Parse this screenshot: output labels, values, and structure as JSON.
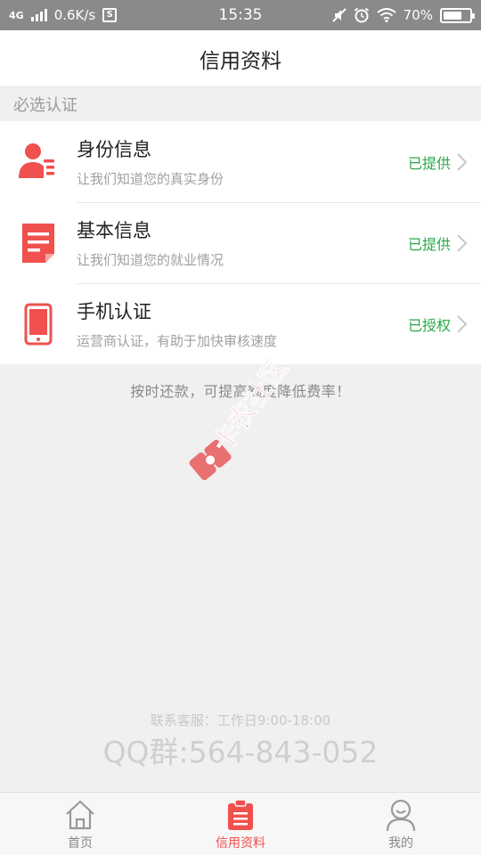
{
  "status_bar": {
    "network": "4G",
    "speed": "0.6K/s",
    "sim_label": "S",
    "time": "15:35",
    "battery": "70%",
    "battery_level": 0.7
  },
  "header": {
    "title": "信用资料"
  },
  "section": {
    "title": "必选认证"
  },
  "items": [
    {
      "title": "身份信息",
      "desc": "让我们知道您的真实身份",
      "status": "已提供",
      "icon": "id-card-icon"
    },
    {
      "title": "基本信息",
      "desc": "让我们知道您的就业情况",
      "status": "已提供",
      "icon": "document-icon"
    },
    {
      "title": "手机认证",
      "desc": "运营商认证，有助于加快审核速度",
      "status": "已授权",
      "icon": "phone-icon"
    }
  ],
  "notice": "按时还款，可提高额度降低费率！",
  "watermark": "卡农社区",
  "contact": {
    "hours": "联系客服：工作日9:00-18:00",
    "qq": "QQ群:564-843-052"
  },
  "nav": [
    {
      "label": "首页",
      "icon": "home-icon"
    },
    {
      "label": "信用资料",
      "icon": "clipboard-icon"
    },
    {
      "label": "我的",
      "icon": "user-icon"
    }
  ],
  "colors": {
    "accent": "#f0504e",
    "status_green": "#2aa84a"
  }
}
